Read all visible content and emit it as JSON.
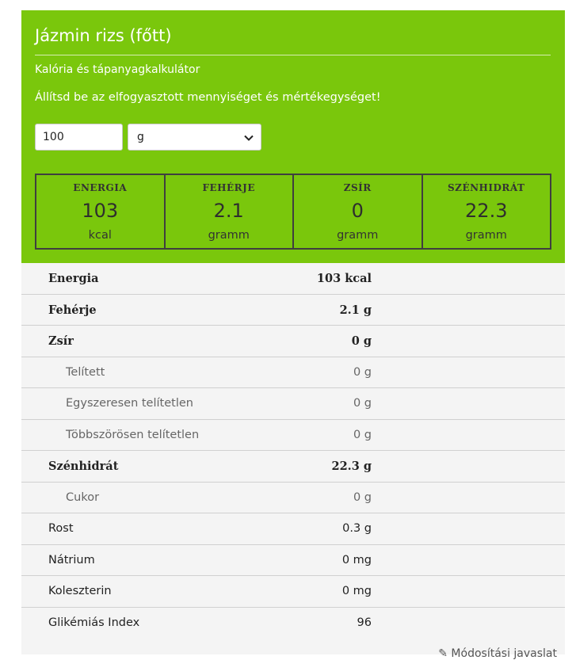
{
  "header": {
    "title": "Jázmin rizs (főtt)",
    "subtitle": "Kalória és tápanyagkalkulátor",
    "instruction": "Állítsd be az elfogyasztott mennyiséget és mértékegységet!"
  },
  "form": {
    "quantity": "100",
    "unit": "g"
  },
  "summary": [
    {
      "label": "ENERGIA",
      "value": "103",
      "unit": "kcal"
    },
    {
      "label": "FEHÉRJE",
      "value": "2.1",
      "unit": "gramm"
    },
    {
      "label": "ZSÍR",
      "value": "0",
      "unit": "gramm"
    },
    {
      "label": "SZÉNHIDRÁT",
      "value": "22.3",
      "unit": "gramm"
    }
  ],
  "nutrients": [
    {
      "name": "Energia",
      "value": "103 kcal"
    },
    {
      "name": "Fehérje",
      "value": "2.1 g"
    },
    {
      "name": "Zsír",
      "value": "0 g"
    },
    {
      "name": "Telített",
      "value": "0 g"
    },
    {
      "name": "Egyszeresen telítetlen",
      "value": "0 g"
    },
    {
      "name": "Többszörösen telítetlen",
      "value": "0 g"
    },
    {
      "name": "Szénhidrát",
      "value": "22.3 g"
    },
    {
      "name": "Cukor",
      "value": "0 g"
    },
    {
      "name": "Rost",
      "value": "0.3 g"
    },
    {
      "name": "Nátrium",
      "value": "0 mg"
    },
    {
      "name": "Koleszterin",
      "value": "0 mg"
    },
    {
      "name": "Glikémiás Index",
      "value": "96"
    }
  ],
  "footer": {
    "edit_label": "Módosítási javaslat",
    "edit_icon": "pencil-icon"
  },
  "colors": {
    "accent": "#7ac70c",
    "table_bg": "#f4f4f4"
  }
}
